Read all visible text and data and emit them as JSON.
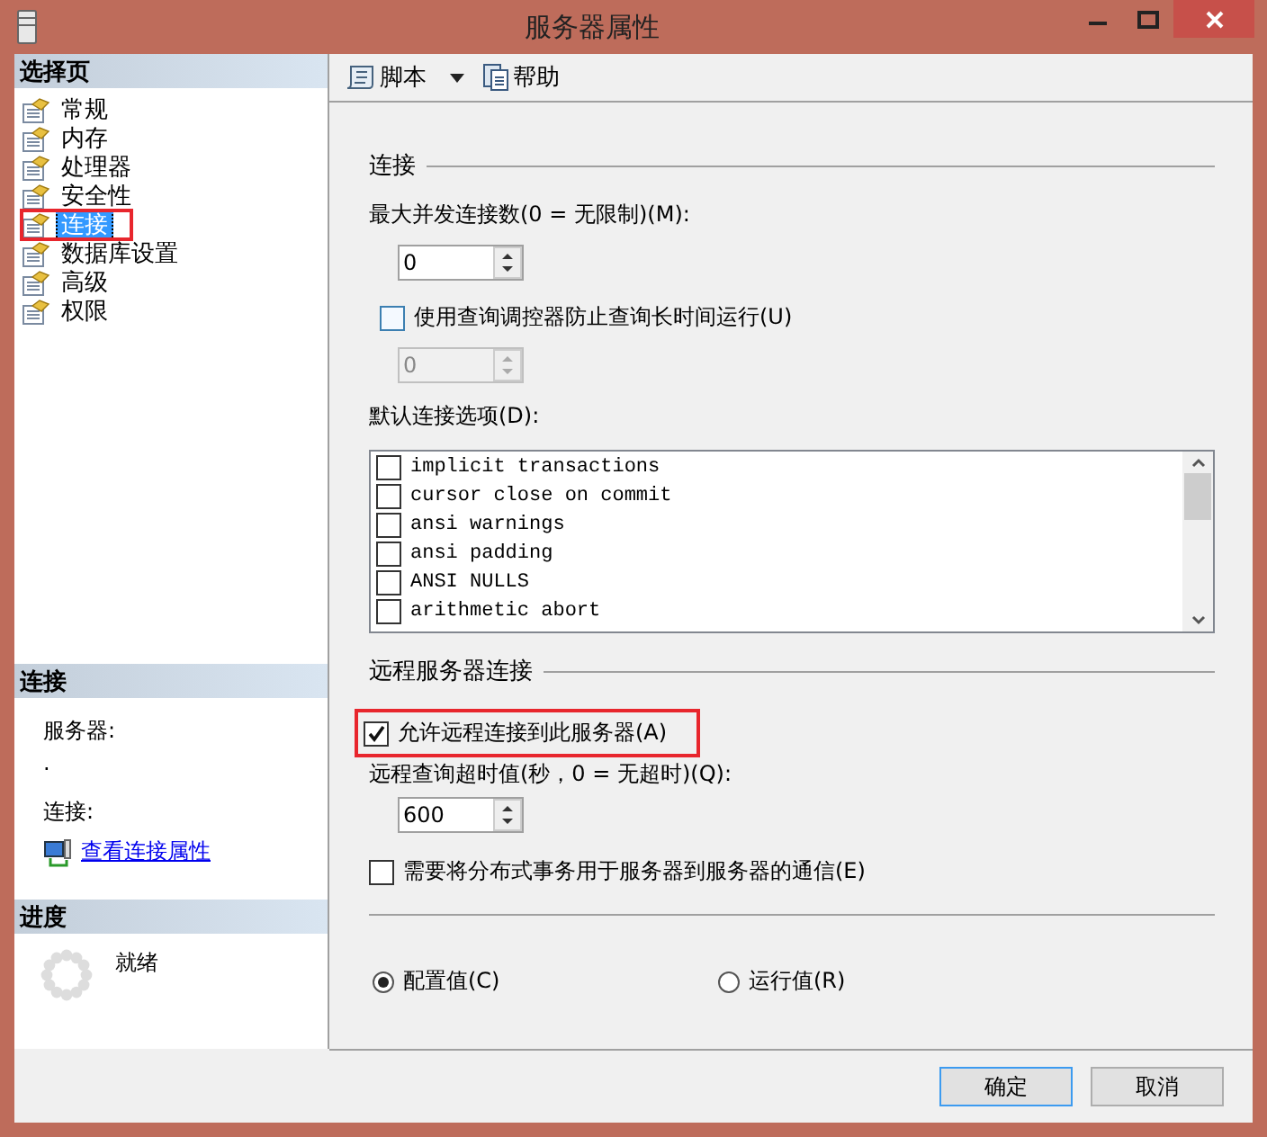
{
  "window": {
    "title": "服务器属性"
  },
  "select_page": {
    "heading": "选择页",
    "items": [
      {
        "label": "常规",
        "selected": false,
        "highlighted": false
      },
      {
        "label": "内存",
        "selected": false,
        "highlighted": false
      },
      {
        "label": "处理器",
        "selected": false,
        "highlighted": false
      },
      {
        "label": "安全性",
        "selected": false,
        "highlighted": false
      },
      {
        "label": "连接",
        "selected": true,
        "highlighted": true
      },
      {
        "label": "数据库设置",
        "selected": false,
        "highlighted": false
      },
      {
        "label": "高级",
        "selected": false,
        "highlighted": false
      },
      {
        "label": "权限",
        "selected": false,
        "highlighted": false
      }
    ]
  },
  "connection_info": {
    "heading": "连接",
    "server_label": "服务器:",
    "server_value": ".",
    "connection_label": "连接:",
    "link": "查看连接属性"
  },
  "progress": {
    "heading": "进度",
    "status": "就绪"
  },
  "toolbar": [
    {
      "label": "脚本",
      "kind": "script"
    },
    {
      "label": "帮助",
      "kind": "help"
    }
  ],
  "connections": {
    "heading": "连接",
    "max_label": "最大并发连接数(0 = 无限制)(M):",
    "max_value": {
      "value": "0",
      "disabled": false
    },
    "governor": {
      "label": "使用查询调控器防止查询长时间运行(U)",
      "checked": false
    },
    "governor_value": {
      "value": "0",
      "disabled": true
    },
    "default_label": "默认连接选项(D):",
    "options": [
      {
        "label": "implicit transactions",
        "checked": false
      },
      {
        "label": "cursor close on commit",
        "checked": false
      },
      {
        "label": "ansi warnings",
        "checked": false
      },
      {
        "label": "ansi padding",
        "checked": false
      },
      {
        "label": "ANSI NULLS",
        "checked": false
      },
      {
        "label": "arithmetic abort",
        "checked": false
      }
    ]
  },
  "remote": {
    "heading": "远程服务器连接",
    "allow": {
      "label": "允许远程连接到此服务器(A)",
      "checked": true,
      "highlighted": true
    },
    "timeout_label": "远程查询超时值(秒，0 = 无超时)(Q):",
    "timeout_value": {
      "value": "600",
      "disabled": false
    },
    "distributed": {
      "label": "需要将分布式事务用于服务器到服务器的通信(E)",
      "checked": false
    }
  },
  "value_mode": [
    {
      "label": "配置值(C)",
      "selected": true
    },
    {
      "label": "运行值(R)",
      "selected": false
    }
  ],
  "buttons": [
    {
      "label": "确定",
      "default": true
    },
    {
      "label": "取消",
      "default": false
    }
  ]
}
